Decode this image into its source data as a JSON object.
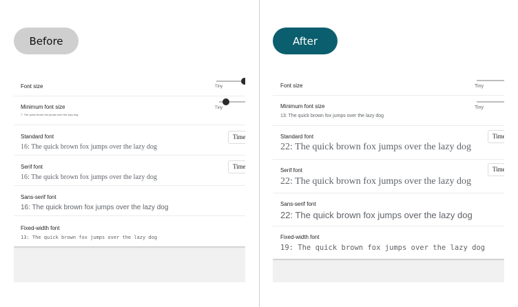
{
  "before": {
    "label": "Before",
    "font_size": {
      "label": "Font size",
      "slider_value": "Tiny",
      "level": 1.0
    },
    "min_font_size": {
      "label": "Minimum font size",
      "slider_value": "Tiny",
      "sample": "7: The quick brown fox jumps over the lazy dog",
      "level": 0.15
    },
    "standard_font": {
      "label": "Standard font",
      "sample": "16: The quick brown fox jumps over the lazy dog",
      "select_value": "Time"
    },
    "serif_font": {
      "label": "Serif font",
      "sample": "16: The quick brown fox jumps over the lazy dog",
      "select_value": "Time"
    },
    "sans_serif_font": {
      "label": "Sans-serif font",
      "sample": "16: The quick brown fox jumps over the lazy dog"
    },
    "fixed_width_font": {
      "label": "Fixed-width font",
      "sample": "13: The quick brown fox jumps over the lazy dog"
    }
  },
  "after": {
    "label": "After",
    "font_size": {
      "label": "Font size",
      "slider_value": "Tiny",
      "level": 0.0
    },
    "min_font_size": {
      "label": "Minimum font size",
      "slider_value": "Tiny",
      "sample": "13: The quick brown fox jumps over the lazy dog",
      "level": 0.0
    },
    "standard_font": {
      "label": "Standard font",
      "sample": "22: The quick brown fox jumps over the lazy dog",
      "select_value": "Time"
    },
    "serif_font": {
      "label": "Serif font",
      "sample": "22: The quick brown fox jumps over the lazy dog",
      "select_value": "Time"
    },
    "sans_serif_font": {
      "label": "Sans-serif font",
      "sample": "22: The quick brown fox jumps over the lazy dog"
    },
    "fixed_width_font": {
      "label": "Fixed-width font",
      "sample": "19: The quick brown fox jumps over the lazy dog"
    }
  },
  "colors": {
    "before_pill": "#cfcfcf",
    "after_pill": "#0b5e6e",
    "thumb": "#2b2b2b"
  }
}
